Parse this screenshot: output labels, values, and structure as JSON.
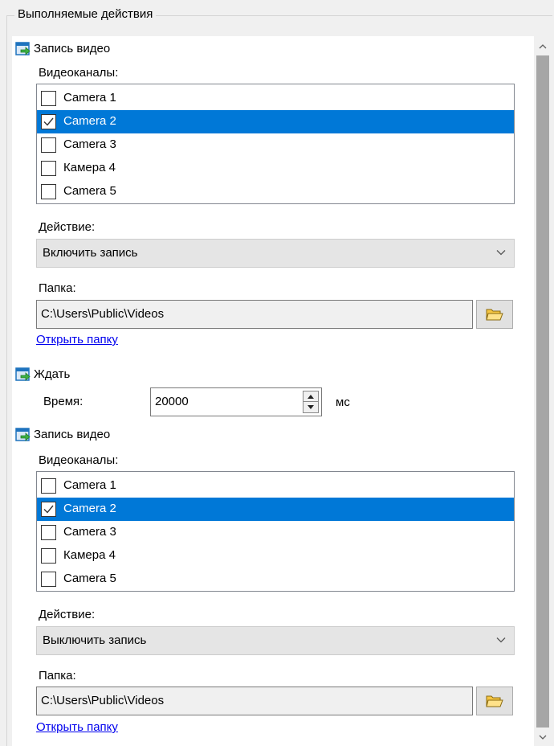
{
  "group": {
    "title": "Выполняемые действия"
  },
  "actions": [
    {
      "title": "Запись видео",
      "channels_label": "Видеоканалы:",
      "channels": [
        {
          "label": "Camera 1",
          "checked": false,
          "selected": false
        },
        {
          "label": "Camera 2",
          "checked": true,
          "selected": true
        },
        {
          "label": "Camera 3",
          "checked": false,
          "selected": false
        },
        {
          "label": "Камера 4",
          "checked": false,
          "selected": false
        },
        {
          "label": "Camera 5",
          "checked": false,
          "selected": false
        }
      ],
      "action_label": "Действие:",
      "action_value": "Включить запись",
      "folder_label": "Папка:",
      "folder_value": "C:\\Users\\Public\\Videos",
      "open_folder": "Открыть папку"
    },
    {
      "title": "Ждать",
      "time_label": "Время:",
      "time_value": "20000",
      "unit": "мс"
    },
    {
      "title": "Запись видео",
      "channels_label": "Видеоканалы:",
      "channels": [
        {
          "label": "Camera 1",
          "checked": false,
          "selected": false
        },
        {
          "label": "Camera 2",
          "checked": true,
          "selected": true
        },
        {
          "label": "Camera 3",
          "checked": false,
          "selected": false
        },
        {
          "label": "Камера 4",
          "checked": false,
          "selected": false
        },
        {
          "label": "Camera 5",
          "checked": false,
          "selected": false
        }
      ],
      "action_label": "Действие:",
      "action_value": "Выключить запись",
      "folder_label": "Папка:",
      "folder_value": "C:\\Users\\Public\\Videos",
      "open_folder": "Открыть папку"
    }
  ],
  "colors": {
    "selection": "#0078d7",
    "link": "#0000ee",
    "icon_blue": "#1e73be",
    "icon_arrow": "#3cb043"
  },
  "icons": {
    "action": "action-arrow-icon",
    "folder": "folder-open-icon",
    "combo": "chevron-down-icon",
    "scroll_up": "chevron-up-icon",
    "scroll_down": "chevron-down-icon",
    "spin_up": "triangle-up-icon",
    "spin_down": "triangle-down-icon",
    "check": "checkmark-icon"
  }
}
